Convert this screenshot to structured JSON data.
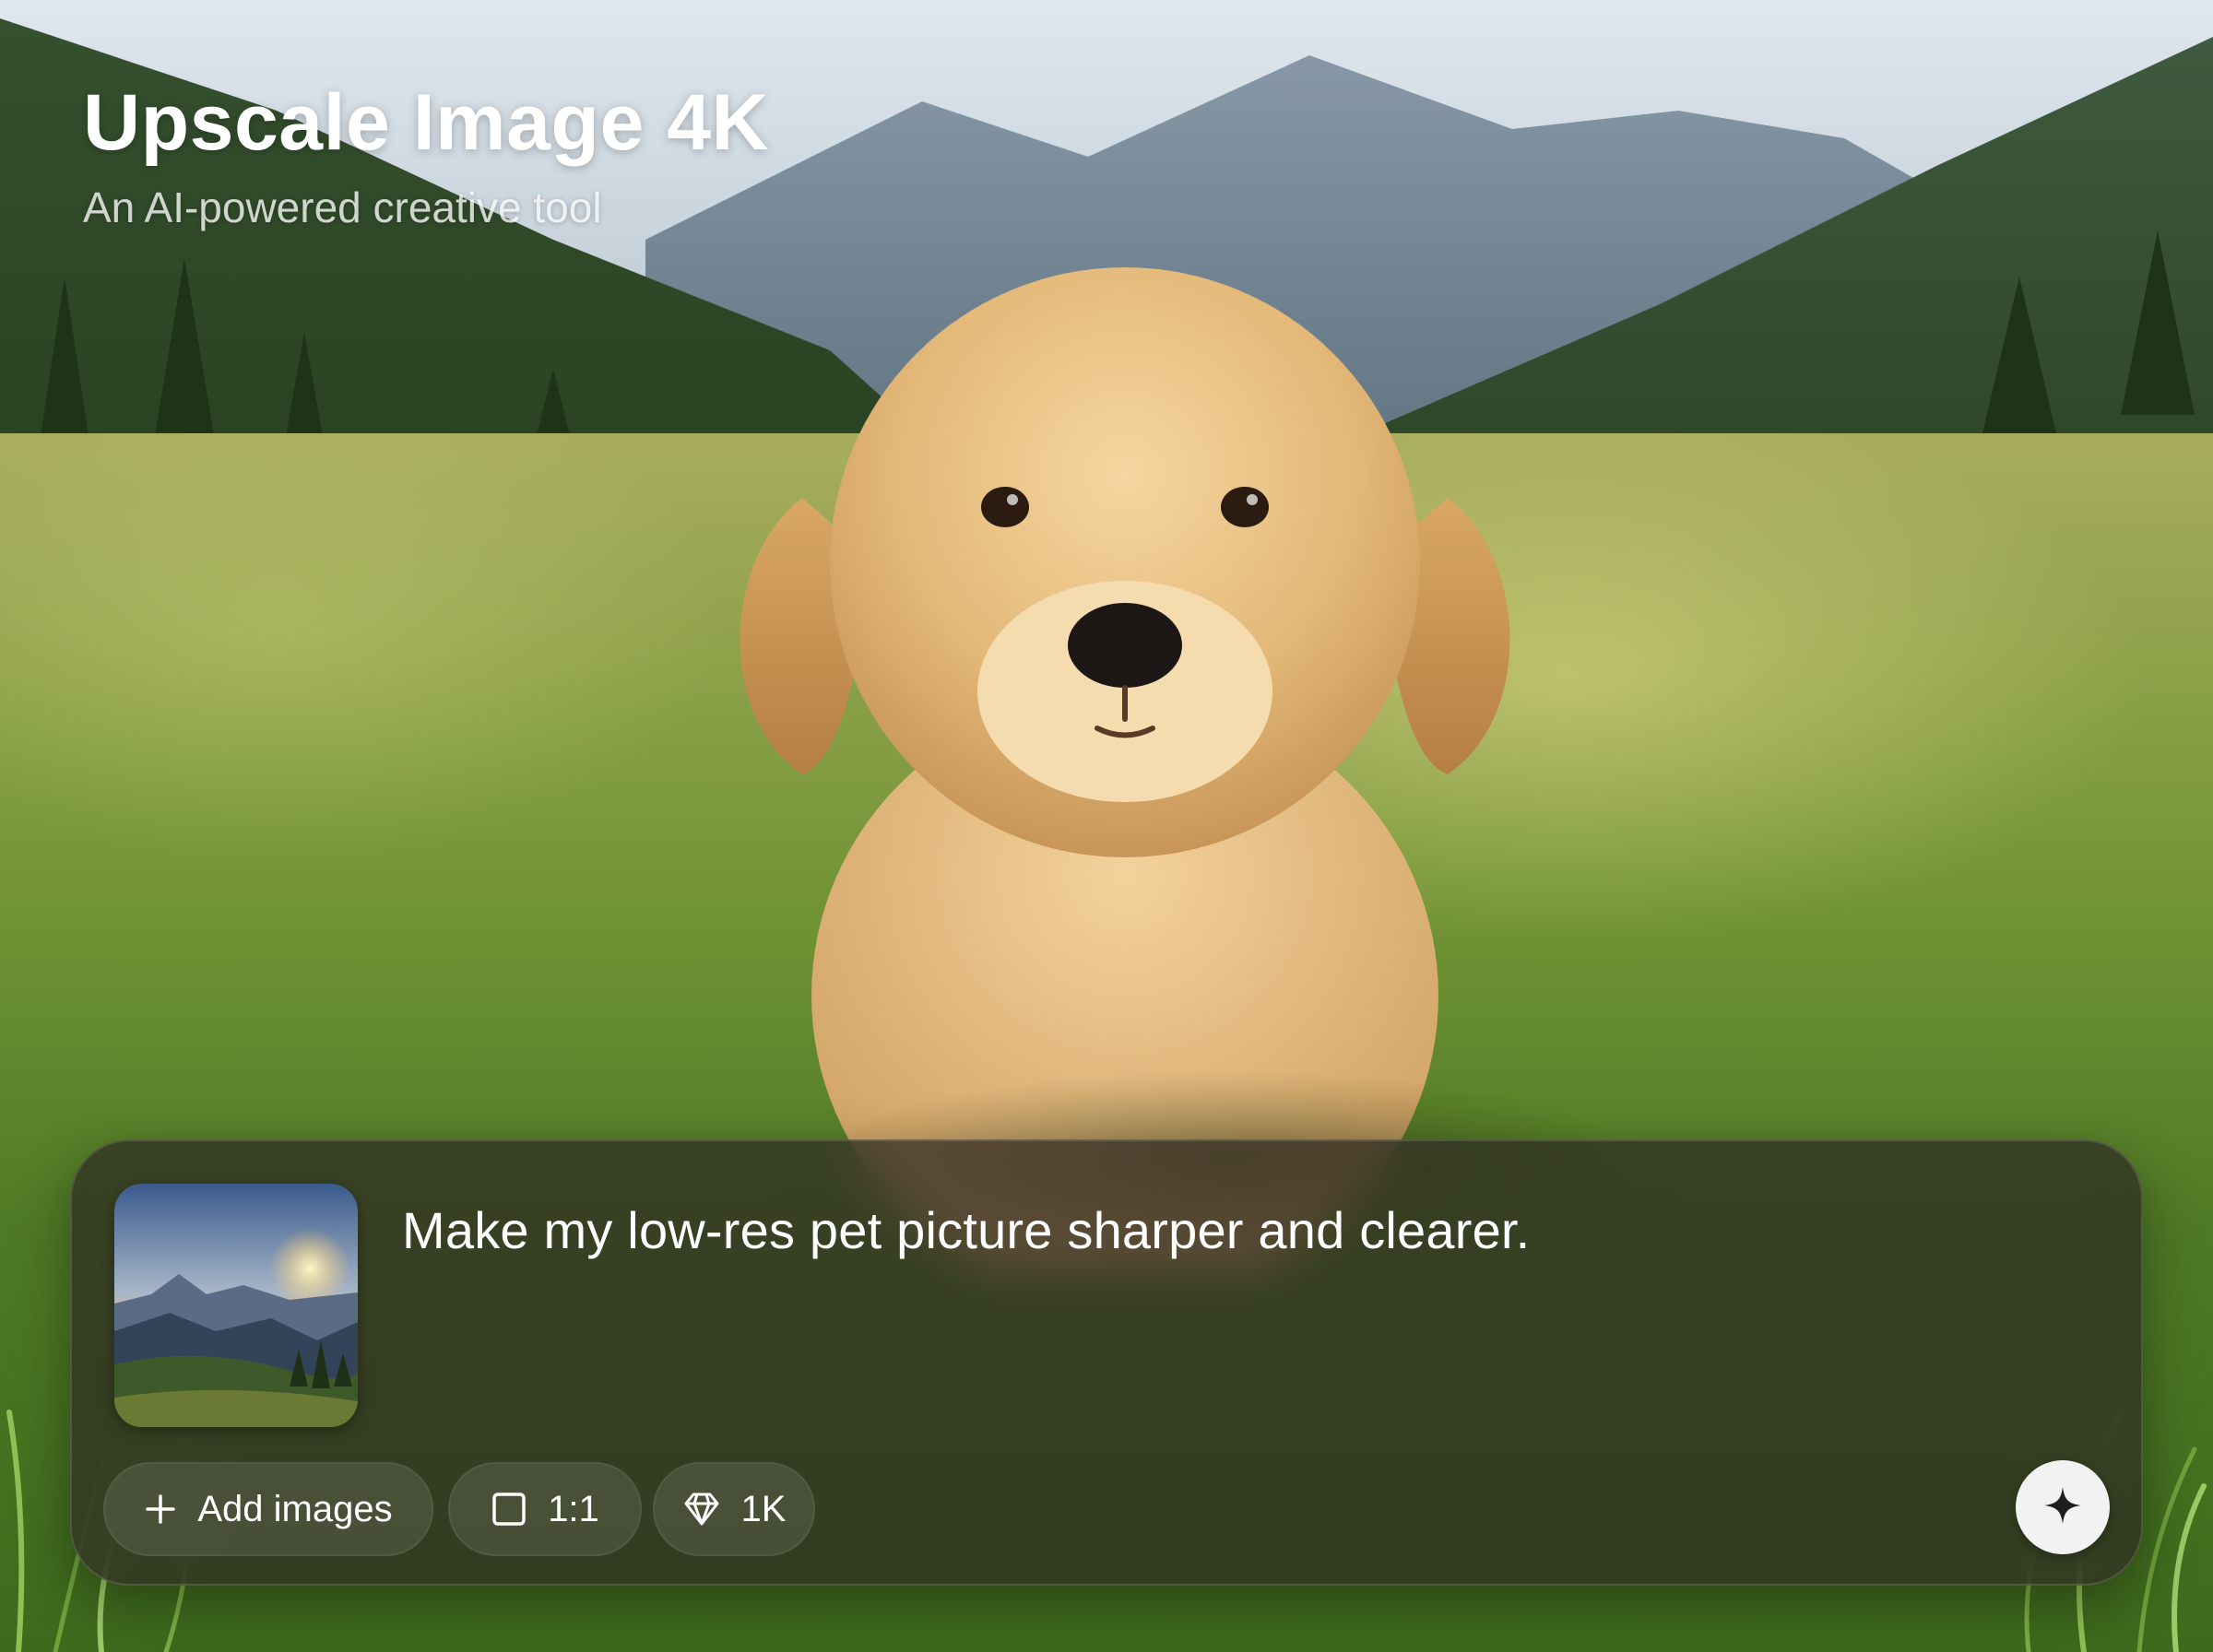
{
  "header": {
    "title": "Upscale Image 4K",
    "subtitle": "An AI-powered creative tool"
  },
  "composer": {
    "prompt": "Make my low-res pet picture sharper and clearer.",
    "add_images_label": "Add images",
    "aspect_ratio_label": "1:1",
    "resolution_label": "1K",
    "icons": {
      "add": "plus-icon",
      "ratio": "square-icon",
      "resolution": "diamond-icon",
      "submit": "sparkle-icon"
    }
  }
}
